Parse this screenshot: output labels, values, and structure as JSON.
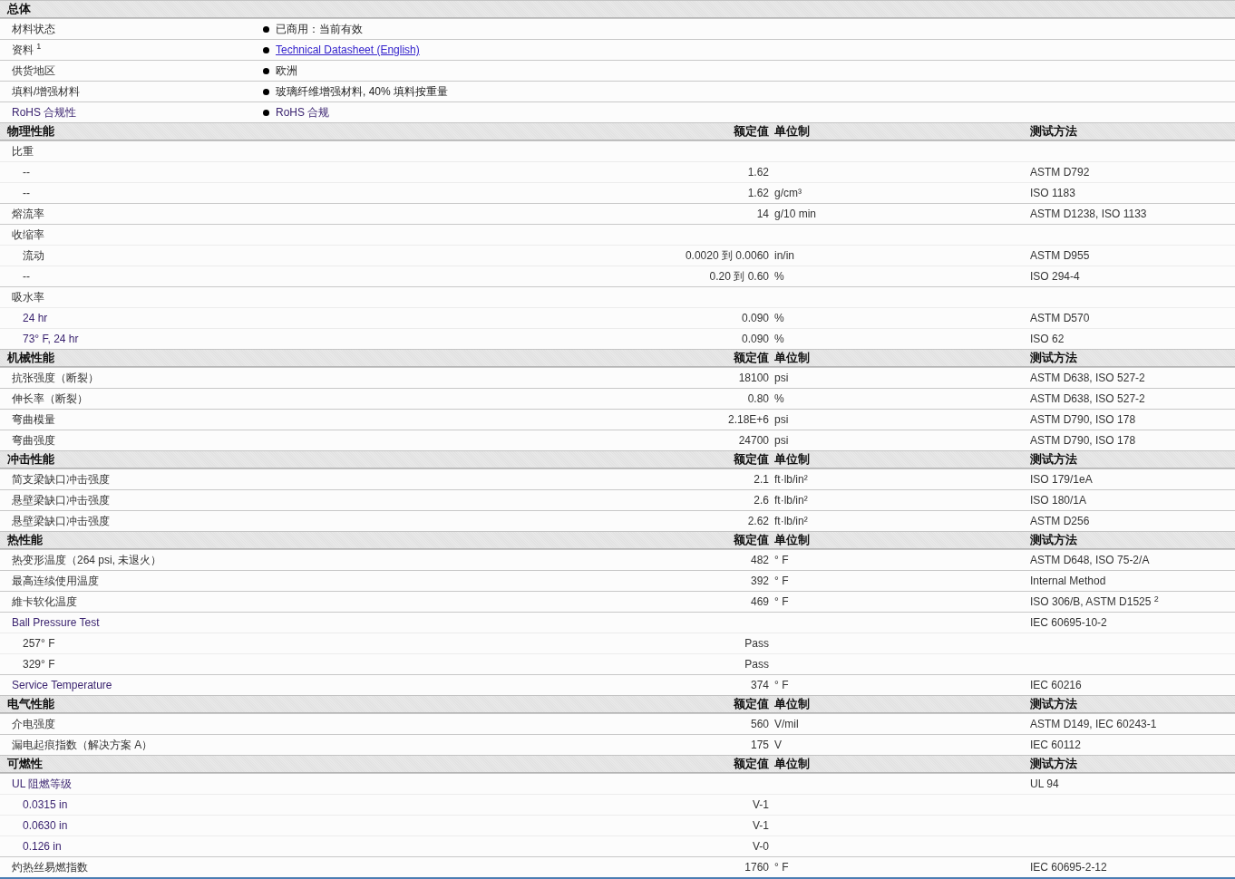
{
  "sections": [
    {
      "title": "总体",
      "kind": "general",
      "rows": [
        {
          "label": "材料状态",
          "linked": false,
          "value": "已商用：当前有效",
          "kind": "text"
        },
        {
          "label": "资料 $^{1}$",
          "linked": false,
          "value": "Technical Datasheet (English)",
          "kind": "link"
        },
        {
          "label": "供货地区",
          "linked": false,
          "value": "欧洲",
          "kind": "text"
        },
        {
          "label": "填料/增强材料",
          "linked": false,
          "value": "玻璃纤维增强材料, 40% 填料按重量",
          "kind": "text"
        },
        {
          "label": "RoHS 合规性",
          "linked": true,
          "value": "RoHS 合规",
          "kind": "linked"
        }
      ]
    },
    {
      "title": "物理性能",
      "kind": "properties",
      "columns": {
        "value": "额定值",
        "unit": "单位制",
        "method": "测试方法"
      },
      "rows": [
        {
          "label": "比重",
          "linked": false,
          "children": [
            {
              "label": "--",
              "linked": false,
              "value": "1.62",
              "method": "ASTM D792"
            },
            {
              "label": "--",
              "linked": false,
              "value": "1.62",
              "unit": "g/cm³",
              "method": "ISO 1183"
            }
          ]
        },
        {
          "label": "熔流率",
          "linked": false,
          "value": "14",
          "unit": "g/10 min",
          "method": "ASTM D1238, ISO 1133"
        },
        {
          "label": "收缩率",
          "linked": false,
          "children": [
            {
              "label": "流动",
              "linked": false,
              "value": "0.0020 到  0.0060",
              "unit": "in/in",
              "method": "ASTM D955"
            },
            {
              "label": "--",
              "linked": false,
              "value": "0.20 到  0.60",
              "unit": "%",
              "method": "ISO 294-4"
            }
          ]
        },
        {
          "label": "吸水率",
          "linked": false,
          "children": [
            {
              "label": "24 hr",
              "linked": true,
              "value": "0.090",
              "unit": "%",
              "method": "ASTM D570"
            },
            {
              "label": "73° F, 24 hr",
              "linked": true,
              "value": "0.090",
              "unit": "%",
              "method": "ISO 62"
            }
          ]
        }
      ]
    },
    {
      "title": "机械性能",
      "kind": "properties",
      "columns": {
        "value": "额定值",
        "unit": "单位制",
        "method": "测试方法"
      },
      "rows": [
        {
          "label": "抗张强度（断裂）",
          "linked": false,
          "value": "18100",
          "unit": "psi",
          "method": "ASTM D638, ISO 527-2"
        },
        {
          "label": "伸长率（断裂）",
          "linked": false,
          "value": "0.80",
          "unit": "%",
          "method": "ASTM D638, ISO 527-2"
        },
        {
          "label": "弯曲模量",
          "linked": false,
          "value": "2.18E+6",
          "unit": "psi",
          "method": "ASTM D790, ISO 178"
        },
        {
          "label": "弯曲强度",
          "linked": false,
          "value": "24700",
          "unit": "psi",
          "method": "ASTM D790, ISO 178"
        }
      ]
    },
    {
      "title": "冲击性能",
      "kind": "properties",
      "columns": {
        "value": "额定值",
        "unit": "单位制",
        "method": "测试方法"
      },
      "rows": [
        {
          "label": "简支梁缺口冲击强度",
          "linked": false,
          "value": "2.1",
          "unit": "ft·lb/in²",
          "method": "ISO 179/1eA"
        },
        {
          "label": "悬壁梁缺口冲击强度",
          "linked": false,
          "value": "2.6",
          "unit": "ft·lb/in²",
          "method": "ISO 180/1A"
        },
        {
          "label": "悬壁梁缺口冲击强度",
          "linked": false,
          "value": "2.62",
          "unit": "ft·lb/in²",
          "method": "ASTM D256"
        }
      ]
    },
    {
      "title": "热性能",
      "kind": "properties",
      "columns": {
        "value": "额定值",
        "unit": "单位制",
        "method": "测试方法"
      },
      "rows": [
        {
          "label": "热变形温度（264 psi, 未退火）",
          "linked": false,
          "value": "482",
          "unit": "° F",
          "method": "ASTM D648, ISO 75-2/A"
        },
        {
          "label": "最高连续使用温度",
          "linked": false,
          "value": "392",
          "unit": "° F",
          "method": "Internal Method"
        },
        {
          "label": "維卡软化温度",
          "linked": false,
          "value": "469",
          "unit": "° F",
          "method": "ISO 306/B, ASTM D1525 $^{2}$"
        },
        {
          "label": "Ball Pressure Test",
          "linked": true,
          "method": "IEC 60695-10-2",
          "children": [
            {
              "label": "257° F",
              "linked": false,
              "value": "Pass"
            },
            {
              "label": "329° F",
              "linked": false,
              "value": "Pass"
            }
          ]
        },
        {
          "label": "Service Temperature",
          "linked": true,
          "value": "374",
          "unit": "° F",
          "method": "IEC 60216"
        }
      ]
    },
    {
      "title": "电气性能",
      "kind": "properties",
      "columns": {
        "value": "额定值",
        "unit": "单位制",
        "method": "测试方法"
      },
      "rows": [
        {
          "label": "介电强度",
          "linked": false,
          "value": "560",
          "unit": "V/mil",
          "method": "ASTM D149, IEC 60243-1"
        },
        {
          "label": "漏电起痕指数（解决方案 A）",
          "linked": false,
          "value": "175",
          "unit": "V",
          "method": "IEC 60112"
        }
      ]
    },
    {
      "title": "可燃性",
      "kind": "properties",
      "columns": {
        "value": "额定值",
        "unit": "单位制",
        "method": "测试方法"
      },
      "rows": [
        {
          "label": "UL 阻燃等级",
          "linked": true,
          "method": "UL 94",
          "children": [
            {
              "label": "0.0315 in",
              "linked": true,
              "value": "V-1"
            },
            {
              "label": "0.0630 in",
              "linked": true,
              "value": "V-1"
            },
            {
              "label": "0.126 in",
              "linked": true,
              "value": "V-0"
            }
          ]
        },
        {
          "label": "灼热丝易燃指数",
          "linked": false,
          "value": "1760",
          "unit": "° F",
          "method": "IEC 60695-2-12"
        }
      ]
    }
  ]
}
